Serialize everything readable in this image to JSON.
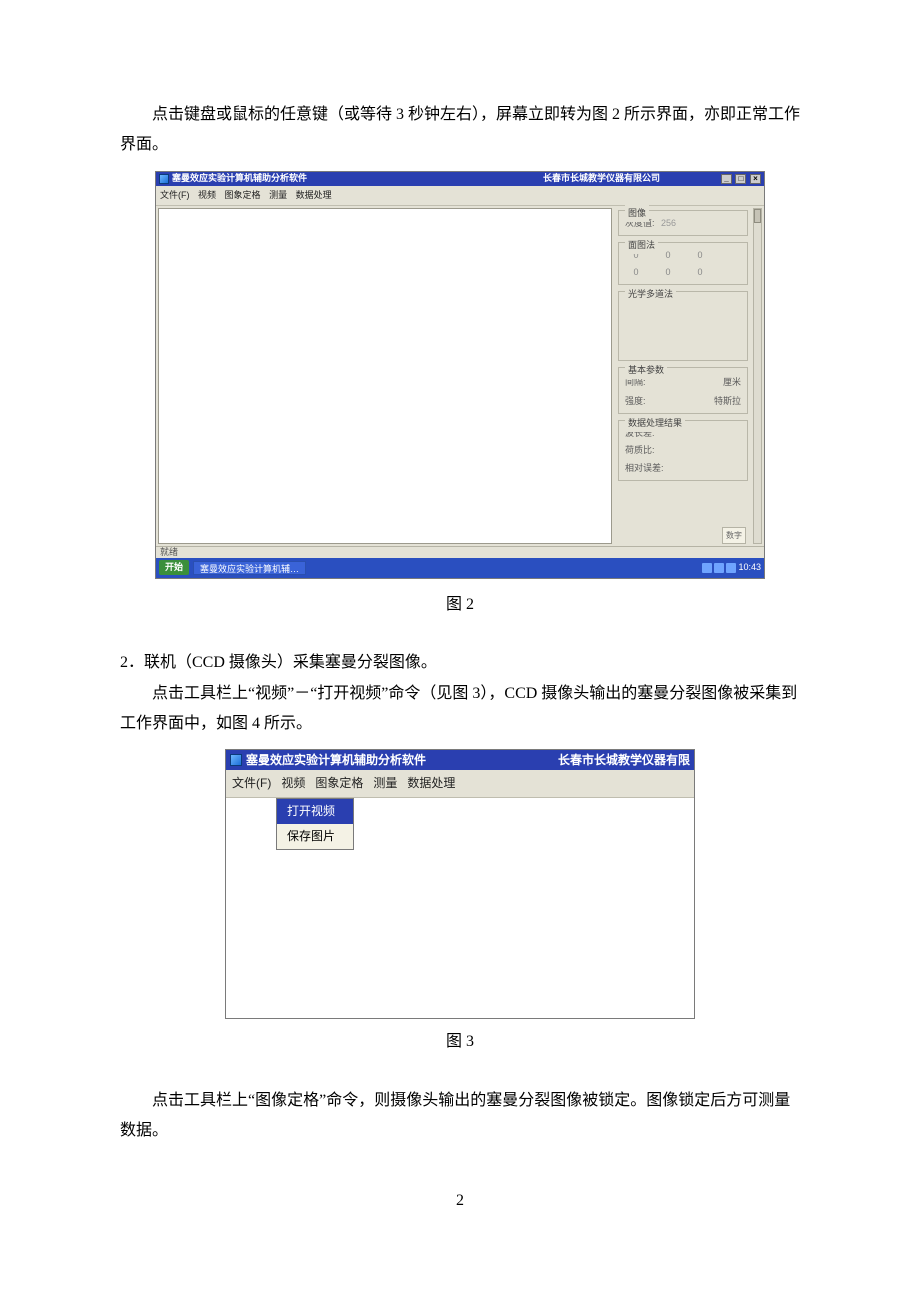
{
  "para1": "点击键盘或鼠标的任意键（或等待 3 秒钟左右），屏幕立即转为图 2 所示界面，亦即正常工作界面。",
  "caption2": "图 2",
  "section2_head": "2．联机（CCD 摄像头）采集塞曼分裂图像。",
  "para2": "点击工具栏上“视频”－“打开视频”命令（见图 3），CCD 摄像头输出的塞曼分裂图像被采集到工作界面中，如图 4 所示。",
  "caption3": "图 3",
  "para3": "点击工具栏上“图像定格”命令，则摄像头输出的塞曼分裂图像被锁定。图像锁定后方可测量数据。",
  "page_number": "2",
  "fig2": {
    "title": "塞曼效应实验计算机辅助分析软件",
    "company": "长春市长城教学仪器有限公司",
    "win_min": "_",
    "win_max": "□",
    "win_close": "×",
    "menu": [
      "文件(F)",
      "视频",
      "图象定格",
      "测量",
      "数据处理"
    ],
    "groups": {
      "image": {
        "title": "图像",
        "grayLabel": "灰度值:",
        "grayValue": "256"
      },
      "surface": {
        "title": "面图法",
        "row1": [
          "0",
          "0",
          "0"
        ],
        "row2": [
          "0",
          "0",
          "0"
        ]
      },
      "multi": {
        "title": "光学多道法"
      },
      "base": {
        "title": "基本参数",
        "rows": [
          {
            "l": "间隔:",
            "r": "厘米"
          },
          {
            "l": "强度:",
            "r": "特斯拉"
          }
        ]
      },
      "result": {
        "title": "数据处理结果",
        "lines": [
          "波长差:",
          "荷质比:",
          "相对误差:"
        ]
      }
    },
    "status_left": "就绪",
    "corner_box": "数字",
    "taskbar": {
      "start": "开始",
      "item": "塞曼效应实验计算机辅…",
      "clock": "10:43"
    }
  },
  "fig3": {
    "title": "塞曼效应实验计算机辅助分析软件",
    "company": "长春市长城教学仪器有限",
    "menu": [
      "文件(F)",
      "视频",
      "图象定格",
      "测量",
      "数据处理"
    ],
    "dropdown": [
      "打开视频",
      "保存图片"
    ]
  }
}
